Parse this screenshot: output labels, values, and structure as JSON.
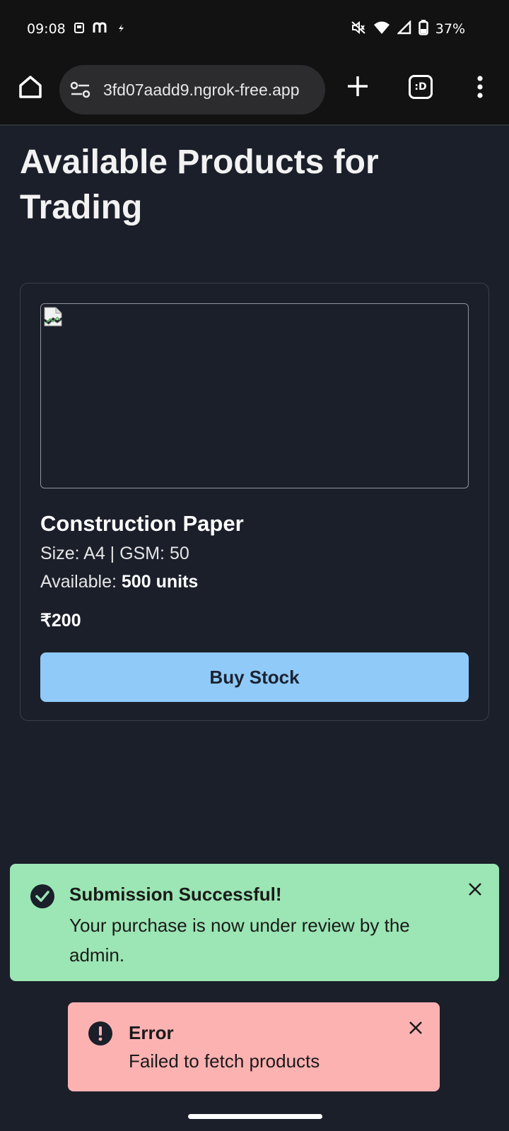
{
  "status_bar": {
    "time": "09:08",
    "battery": "37%",
    "icons": [
      "wallet-icon",
      "m-app-icon",
      "flash-icon",
      "mute-icon",
      "wifi-icon",
      "signal-icon",
      "battery-icon"
    ]
  },
  "browser": {
    "url": "3fd07aadd9.ngrok-free.app",
    "tabs_label": ":D"
  },
  "page": {
    "title": "Available Products for Trading"
  },
  "product": {
    "name": "Construction Paper",
    "spec": "Size: A4 | GSM: 50",
    "available_label": "Available: ",
    "available_value": "500 units",
    "price": "₹200",
    "buy_label": "Buy Stock"
  },
  "toasts": {
    "success": {
      "title": "Submission Successful!",
      "message": "Your purchase is now under review by the admin."
    },
    "error": {
      "title": "Error",
      "message": "Failed to fetch products"
    }
  },
  "colors": {
    "background": "#1b1f2a",
    "button": "#90caf9",
    "success_toast": "#9be6b4",
    "error_toast": "#fdb2b2"
  }
}
